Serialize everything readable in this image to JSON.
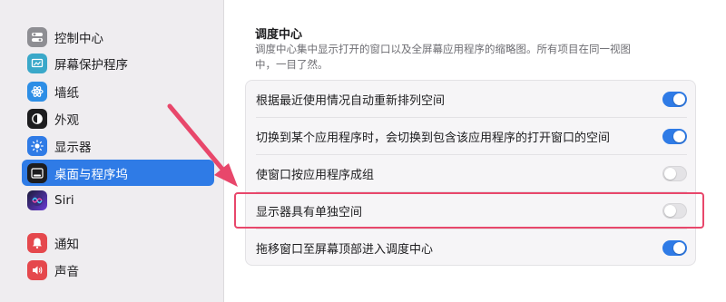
{
  "sidebar": {
    "items": [
      {
        "label": "控制中心",
        "icon": "control-center-icon",
        "color": "#8e8e93"
      },
      {
        "label": "屏幕保护程序",
        "icon": "screen-saver-icon",
        "color": "#3aa8c9"
      },
      {
        "label": "墙纸",
        "icon": "wallpaper-icon",
        "color": "#2d8ee6"
      },
      {
        "label": "外观",
        "icon": "appearance-icon",
        "color": "#1d1d1f"
      },
      {
        "label": "显示器",
        "icon": "displays-icon",
        "color": "#2f7be6"
      },
      {
        "label": "桌面与程序坞",
        "icon": "desktop-dock-icon",
        "color": "#1d1d1f",
        "selected": true
      },
      {
        "label": "Siri",
        "icon": "siri-icon",
        "color": "#6a3bd6"
      },
      {
        "label": "通知",
        "icon": "notifications-icon",
        "color": "#e5484d"
      },
      {
        "label": "声音",
        "icon": "sound-icon",
        "color": "#e5484d"
      }
    ]
  },
  "main": {
    "section_title": "调度中心",
    "section_desc": "调度中心集中显示打开的窗口以及全屏幕应用程序的缩略图。所有项目在同一视图中，一目了然。",
    "settings": [
      {
        "label": "根据最近使用情况自动重新排列空间",
        "on": true
      },
      {
        "label": "切换到某个应用程序时，会切换到包含该应用程序的打开窗口的空间",
        "on": true
      },
      {
        "label": "使窗口按应用程序成组",
        "on": false
      },
      {
        "label": "显示器具有单独空间",
        "on": false
      },
      {
        "label": "拖移窗口至屏幕顶部进入调度中心",
        "on": true
      }
    ]
  },
  "colors": {
    "accent": "#2f7be6",
    "highlight": "#e8476b"
  }
}
